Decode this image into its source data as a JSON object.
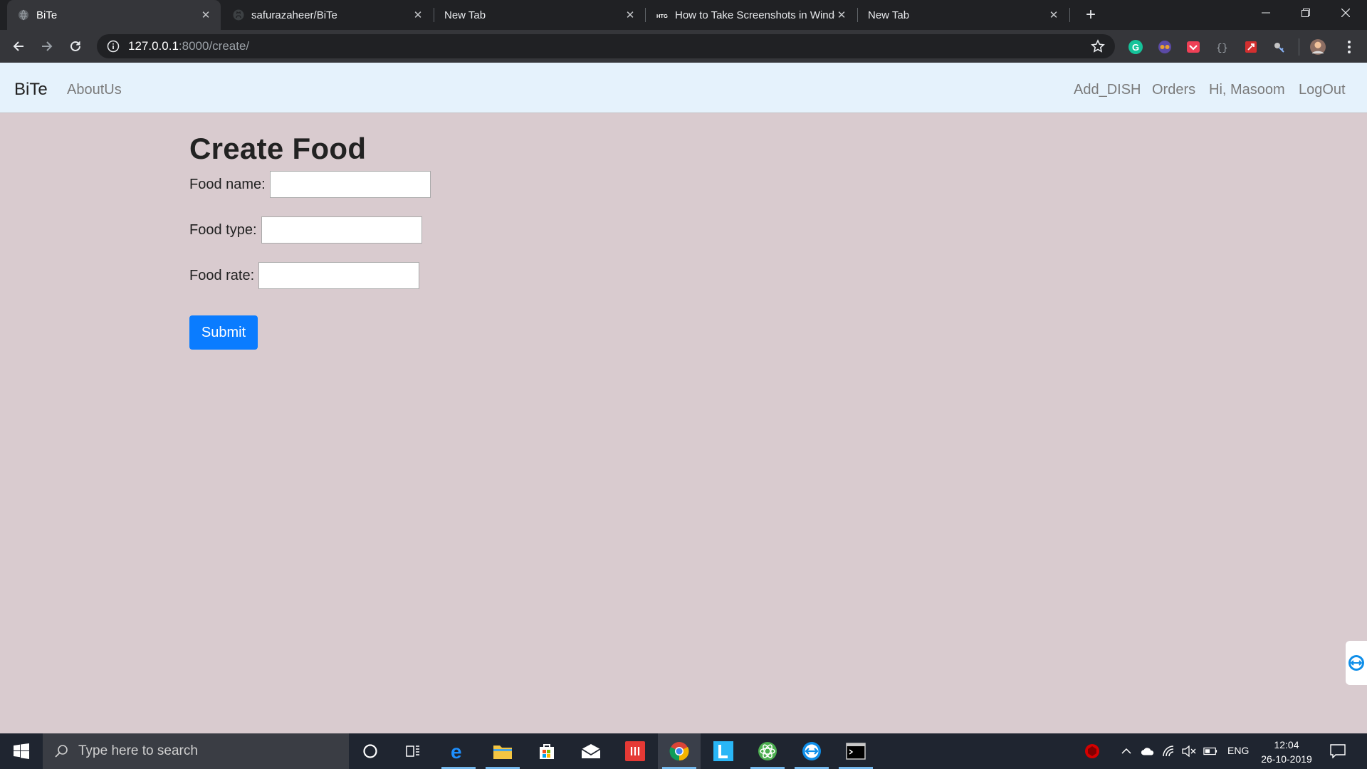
{
  "browser": {
    "tabs": [
      {
        "title": "BiTe",
        "favicon": "globe-icon",
        "active": true
      },
      {
        "title": "safurazaheer/BiTe",
        "favicon": "github-icon",
        "active": false
      },
      {
        "title": "New Tab",
        "favicon": "",
        "active": false
      },
      {
        "title": "How to Take Screenshots in Windo",
        "favicon": "htg-icon",
        "active": false
      },
      {
        "title": "New Tab",
        "favicon": "",
        "active": false
      }
    ],
    "url_host": "127.0.0.1",
    "url_path": ":8000/create/"
  },
  "site": {
    "brand": "BiTe",
    "nav_left": [
      "AboutUs"
    ],
    "nav_right": [
      "Add_DISH",
      "Orders",
      "Hi, Masoom",
      "LogOut"
    ]
  },
  "form": {
    "title": "Create Food",
    "fields": [
      {
        "label": "Food name:",
        "value": ""
      },
      {
        "label": "Food type:",
        "value": ""
      },
      {
        "label": "Food rate:",
        "value": ""
      }
    ],
    "submit_label": "Submit"
  },
  "taskbar": {
    "search_placeholder": "Type here to search",
    "lang": "ENG",
    "time": "12:04",
    "date": "26-10-2019"
  },
  "colors": {
    "page_bg": "#d9cbcf",
    "navbar_bg": "#e5f2fc",
    "submit_bg": "#0a7cff"
  }
}
